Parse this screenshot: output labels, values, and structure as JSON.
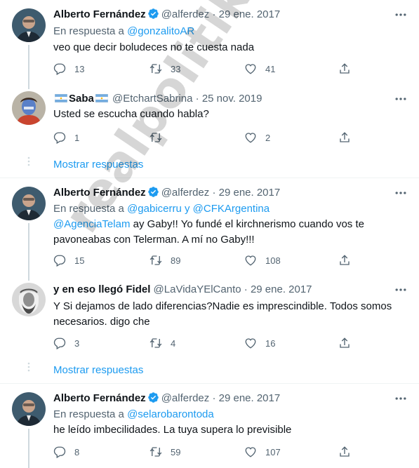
{
  "colors": {
    "link": "#1d9bf0",
    "muted": "#536471",
    "verified": "#1d9bf0"
  },
  "icons": [
    "verified-badge-icon",
    "more-icon",
    "reply-icon",
    "retweet-icon",
    "like-icon",
    "share-icon",
    "argentina-flag-icon"
  ],
  "tweets": [
    {
      "name": "Alberto Fernández",
      "handle": "@alferdez",
      "dot": "·",
      "date": "29 ene. 2017",
      "reply_prefix": "En respuesta a ",
      "reply_to": "@gonzalitoAR",
      "text": "veo que decir boludeces no te cuesta nada",
      "replies": "13",
      "retweets": "33",
      "likes": "41"
    },
    {
      "name": "Saba",
      "handle": "@EtchartSabrina",
      "dot": "·",
      "date": "25 nov. 2019",
      "text": "Usted se escucha cuando habla?",
      "replies": "1",
      "retweets": "",
      "likes": "2"
    },
    {
      "name": "Alberto Fernández",
      "handle": "@alferdez",
      "dot": "·",
      "date": "29 ene. 2017",
      "reply_prefix": "En respuesta a ",
      "reply_to": "@gabicerru y @CFKArgentina",
      "text_mention": "@AgenciaTelam",
      "text": " ay Gaby!! Yo fundé el kirchnerismo cuando vos te pavoneabas con Telerman. A mí no Gaby!!!",
      "replies": "15",
      "retweets": "89",
      "likes": "108"
    },
    {
      "name": "y en eso llegó Fidel",
      "handle": "@LaVidaYElCanto",
      "dot": "·",
      "date": "29 ene. 2017",
      "text": "Y Si dejamos de lado diferencias?Nadie es imprescindible. Todos somos necesarios. digo che",
      "replies": "3",
      "retweets": "4",
      "likes": "16"
    },
    {
      "name": "Alberto Fernández",
      "handle": "@alferdez",
      "dot": "·",
      "date": "29 ene. 2017",
      "reply_prefix": "En respuesta a ",
      "reply_to": "@selarobarontoda",
      "text": "he leído imbecilidades. La tuya supera lo previsible",
      "replies": "8",
      "retweets": "59",
      "likes": "107"
    }
  ],
  "show_more_label": "Mostrar respuestas",
  "watermark": "realpolitik.com.ar"
}
